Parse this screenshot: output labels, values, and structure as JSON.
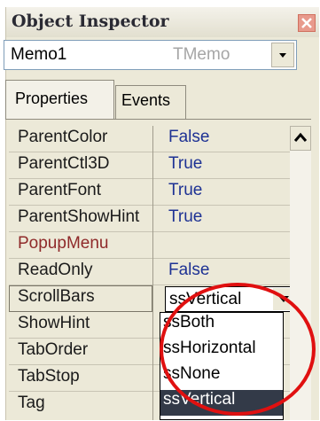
{
  "window": {
    "title": "Object Inspector"
  },
  "object_selector": {
    "name": "Memo1",
    "type": "TMemo"
  },
  "tabs": [
    {
      "label": "Properties",
      "active": true
    },
    {
      "label": "Events",
      "active": false
    }
  ],
  "properties": [
    {
      "name": "ParentColor",
      "value": "False"
    },
    {
      "name": "ParentCtl3D",
      "value": "True"
    },
    {
      "name": "ParentFont",
      "value": "True"
    },
    {
      "name": "ParentShowHint",
      "value": "True"
    },
    {
      "name": "PopupMenu",
      "value": ""
    },
    {
      "name": "ReadOnly",
      "value": "False"
    },
    {
      "name": "ScrollBars",
      "value": "ssVertical"
    },
    {
      "name": "ShowHint",
      "value": ""
    },
    {
      "name": "TabOrder",
      "value": ""
    },
    {
      "name": "TabStop",
      "value": ""
    },
    {
      "name": "Tag",
      "value": ""
    }
  ],
  "dropdown": {
    "selected": "ssVertical",
    "options": [
      "ssBoth",
      "ssHorizontal",
      "ssNone",
      "ssVertical"
    ]
  },
  "colors": {
    "annotation_circle": "#e01010",
    "value_text": "#1e3294",
    "event_property_text": "#8f2a2a",
    "selected_option": "#333a48"
  },
  "icons": {
    "close": "close-icon",
    "combo_arrow": "chevron-down-icon",
    "scroll_up": "chevron-up-icon"
  }
}
